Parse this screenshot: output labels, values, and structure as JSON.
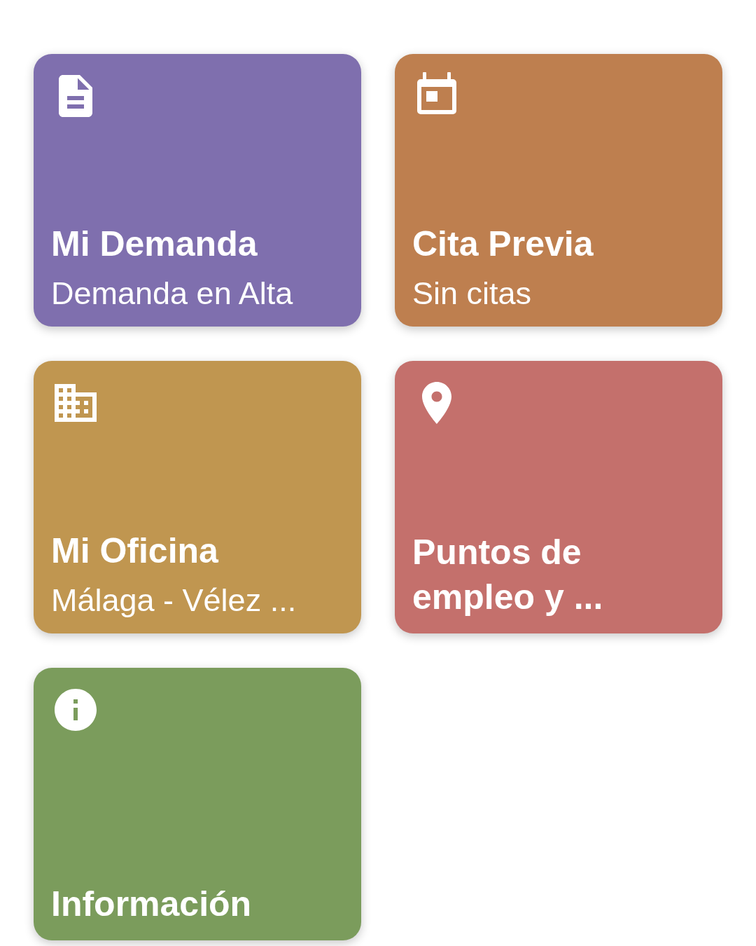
{
  "tiles": [
    {
      "kind": "document",
      "title": "Mi Demanda",
      "subtitle": "Demanda en Alta",
      "color": "#7f6fae"
    },
    {
      "kind": "calendar",
      "title": "Cita Previa",
      "subtitle": "Sin citas",
      "color": "#be7f4f"
    },
    {
      "kind": "building",
      "title": "Mi Oficina",
      "subtitle": "Málaga - Vélez ...",
      "color": "#c09650"
    },
    {
      "kind": "pin",
      "title": "Puntos de empleo y ...",
      "color": "#c4706c"
    },
    {
      "kind": "info",
      "title": "Información",
      "color": "#7b9c5c"
    }
  ]
}
